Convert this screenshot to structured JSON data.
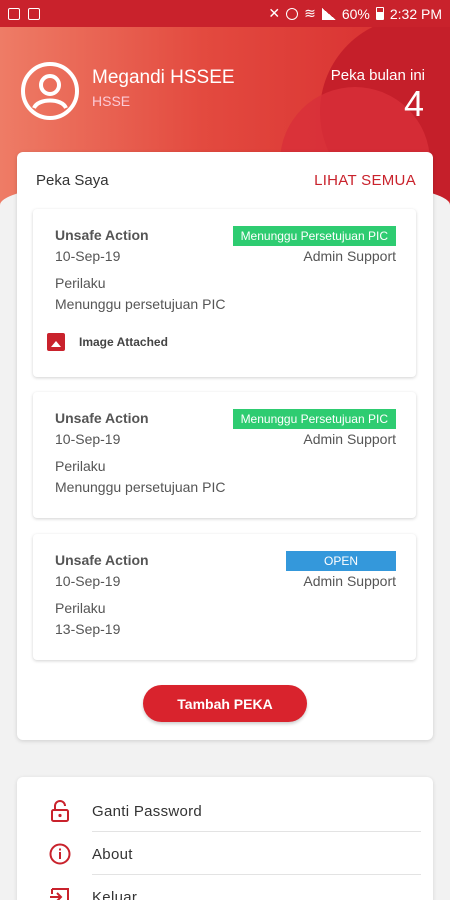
{
  "status_bar": {
    "battery": "60%",
    "time": "2:32 PM"
  },
  "header": {
    "user_name": "Megandi HSSEE",
    "department": "HSSE",
    "month_label": "Peka bulan ini",
    "month_count": "4"
  },
  "card": {
    "title": "Peka Saya",
    "see_all": "LIHAT SEMUA",
    "items": [
      {
        "type": "Unsafe Action",
        "date": "10-Sep-19",
        "badge": "Menunggu Persetujuan PIC",
        "badge_color": "#2ecc71",
        "support": "Admin Support",
        "category": "Perilaku",
        "description": "Menunggu persetujuan PIC",
        "attachment": "Image Attached"
      },
      {
        "type": "Unsafe Action",
        "date": "10-Sep-19",
        "badge": "Menunggu Persetujuan PIC",
        "badge_color": "#2ecc71",
        "support": "Admin Support",
        "category": "Perilaku",
        "description": "Menunggu persetujuan PIC"
      },
      {
        "type": "Unsafe Action",
        "date": "10-Sep-19",
        "badge": "OPEN",
        "badge_color": "#3498db",
        "support": "Admin Support",
        "category": "Perilaku",
        "description": "13-Sep-19"
      }
    ],
    "add_button": "Tambah PEKA"
  },
  "menu": {
    "items": [
      {
        "label": "Ganti Password",
        "icon": "lock-icon"
      },
      {
        "label": "About",
        "icon": "info-icon"
      },
      {
        "label": "Keluar",
        "icon": "logout-icon"
      }
    ]
  },
  "colors": {
    "accent": "#c9222c",
    "green": "#2ecc71",
    "blue": "#3498db"
  }
}
